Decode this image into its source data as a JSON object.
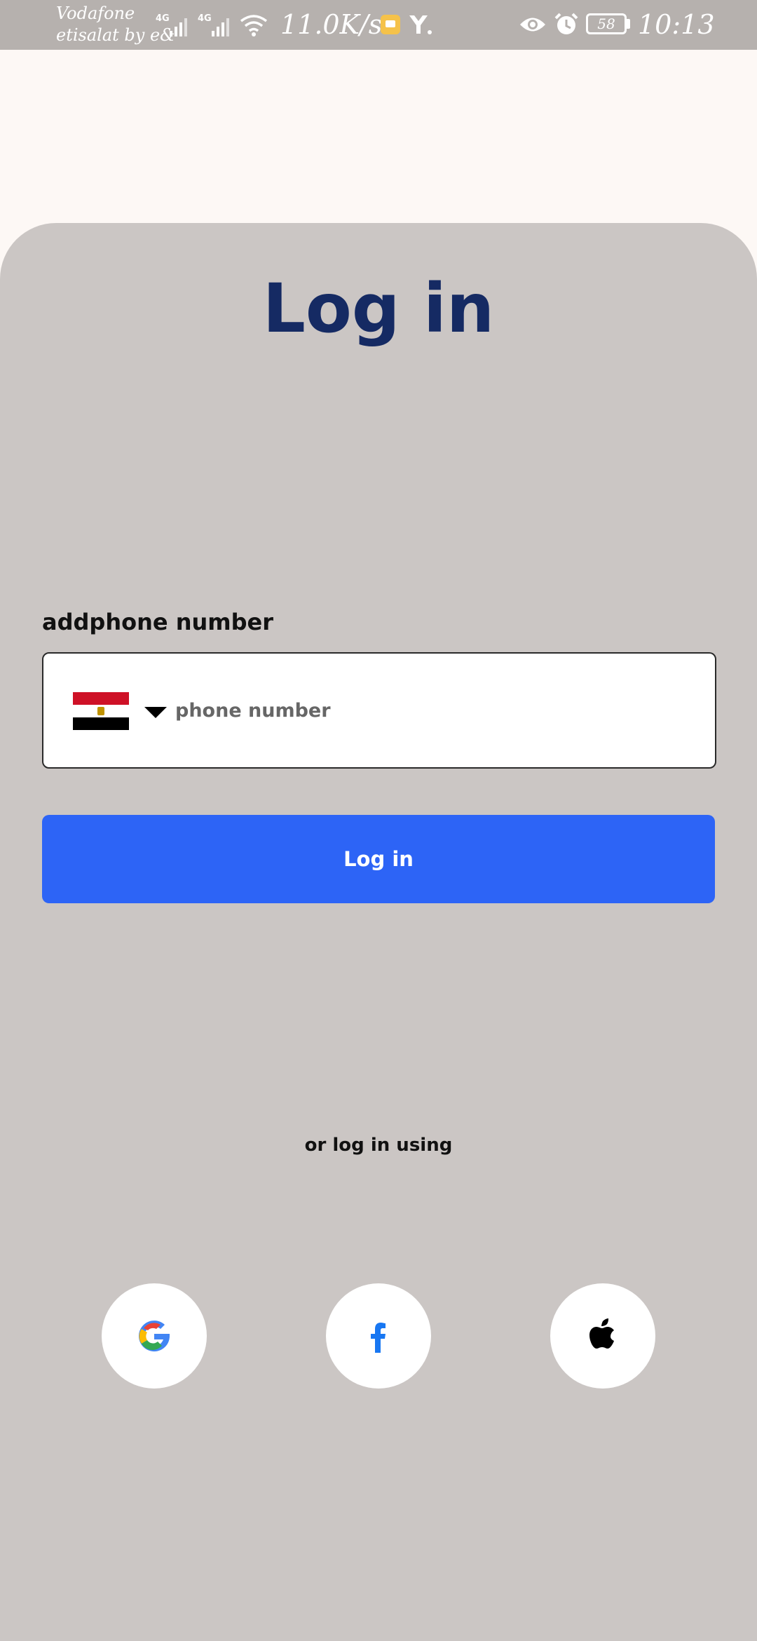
{
  "status_bar": {
    "carrier_line1": "Vodafone",
    "carrier_line2": "etisalat by e&",
    "net_speed": "11.0K/s",
    "battery": "58",
    "time": "10:13",
    "icons": [
      "signal-4g-icon",
      "signal-4g-icon",
      "wifi-icon",
      "app-notification-icon",
      "y-app-icon",
      "eye-icon",
      "alarm-icon",
      "battery-icon"
    ]
  },
  "login": {
    "title": "Log in",
    "phone_label": "addphone number",
    "country_flag": "egypt-flag-icon",
    "phone_placeholder": "phone number",
    "phone_value": "",
    "login_button": "Log in",
    "or_text": "or log in using",
    "social": [
      "google-icon",
      "facebook-icon",
      "apple-icon"
    ]
  },
  "colors": {
    "title": "#152a63",
    "button": "#2d64f6",
    "sheet": "#cbc6c4",
    "background": "#fdf8f5",
    "status_bar": "#b6b1ae"
  }
}
